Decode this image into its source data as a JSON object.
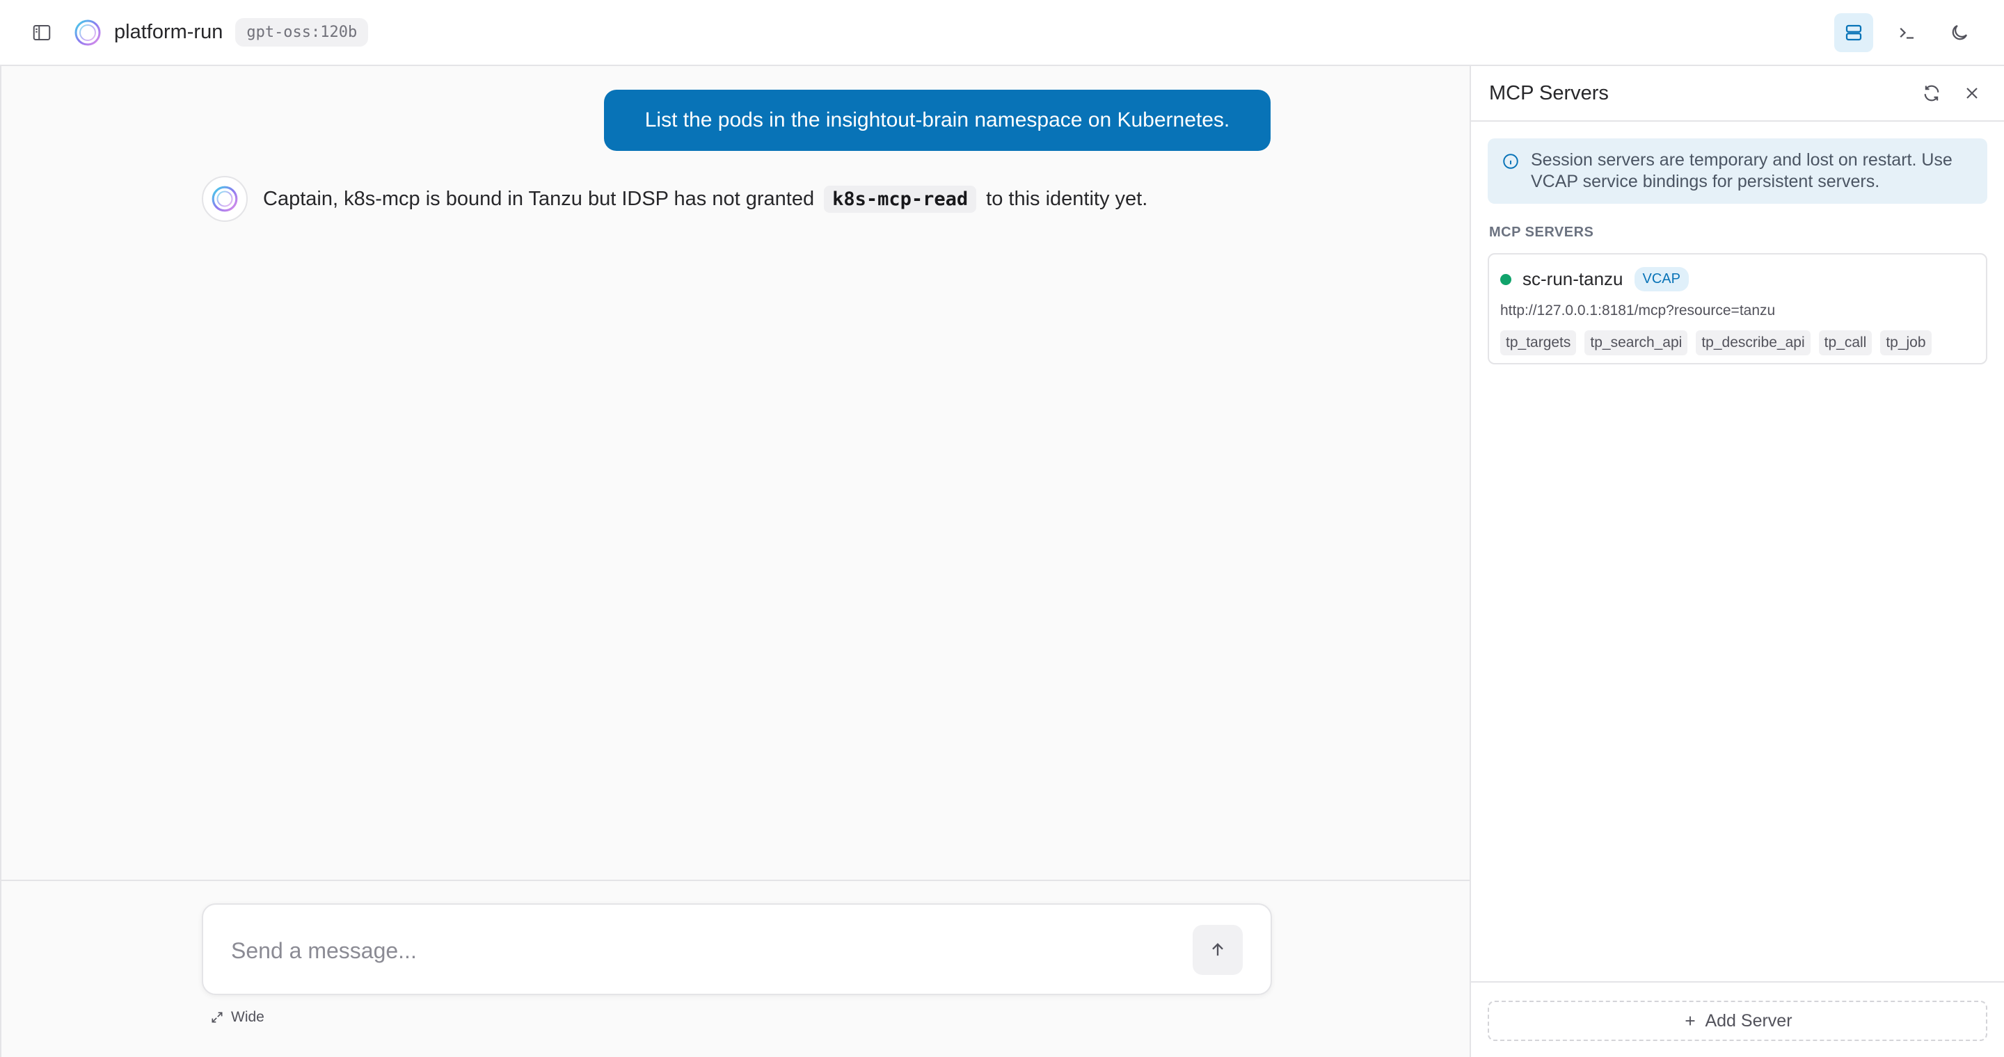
{
  "header": {
    "app_title": "platform-run",
    "model": "gpt-oss:120b",
    "icons": {
      "sidebar_toggle": "sidebar-toggle-icon",
      "logo": "ring-logo-icon",
      "servers": "server-stack-icon",
      "terminal": "terminal-icon",
      "theme": "moon-icon"
    }
  },
  "chat": {
    "user_message": "List the pods in the insightout-brain namespace on Kubernetes.",
    "assistant_message": {
      "before": "Captain, k8s-mcp is bound in Tanzu but IDSP has not granted",
      "code": "k8s-mcp-read",
      "after": "to this identity yet."
    },
    "composer": {
      "placeholder": "Send a message...",
      "wide_label": "Wide"
    }
  },
  "panel": {
    "title": "MCP Servers",
    "info": "Session servers are temporary and lost on restart. Use VCAP service bindings for persistent servers.",
    "section_label": "MCP SERVERS",
    "servers": [
      {
        "name": "sc-run-tanzu",
        "badge": "VCAP",
        "url": "http://127.0.0.1:8181/mcp?resource=tanzu",
        "status_color": "#10a36b",
        "tools": [
          "tp_targets",
          "tp_search_api",
          "tp_describe_api",
          "tp_call",
          "tp_job"
        ]
      }
    ],
    "add_server_label": "Add Server"
  },
  "colors": {
    "accent": "#0873b7",
    "accent_soft": "#e0f0fa",
    "status_ok": "#10a36b"
  }
}
